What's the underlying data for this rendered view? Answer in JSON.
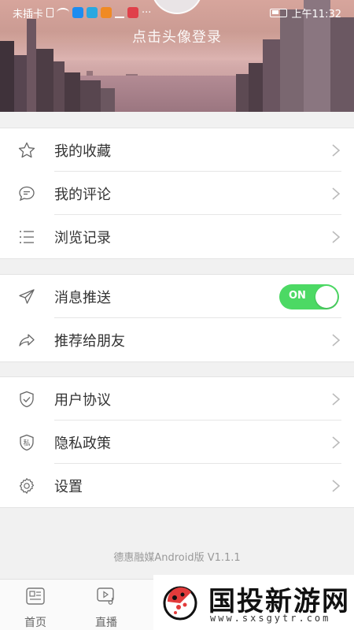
{
  "status_bar": {
    "carrier": "未插卡",
    "time": "上午11:32",
    "more": "···"
  },
  "header": {
    "login_prompt": "点击头像登录"
  },
  "menu": {
    "group1": [
      {
        "label": "我的收藏",
        "icon": "star-icon"
      },
      {
        "label": "我的评论",
        "icon": "comment-icon"
      },
      {
        "label": "浏览记录",
        "icon": "list-icon"
      }
    ],
    "group2": [
      {
        "label": "消息推送",
        "icon": "send-icon",
        "toggle": "ON"
      },
      {
        "label": "推荐给朋友",
        "icon": "share-icon"
      }
    ],
    "group3": [
      {
        "label": "用户协议",
        "icon": "shield-check-icon"
      },
      {
        "label": "隐私政策",
        "icon": "privacy-shield-icon",
        "icon_text": "私"
      },
      {
        "label": "设置",
        "icon": "gear-icon"
      }
    ]
  },
  "version": "德惠融媒Android版 V1.1.1",
  "tabbar": {
    "tabs": [
      {
        "label": "首页",
        "icon": "news-icon"
      },
      {
        "label": "直播",
        "icon": "video-icon"
      }
    ]
  },
  "watermark": {
    "title": "国投新游网",
    "url": "www.sxsgytr.com"
  },
  "colors": {
    "toggle_on": "#4cd964",
    "background": "#f1f1f1"
  }
}
